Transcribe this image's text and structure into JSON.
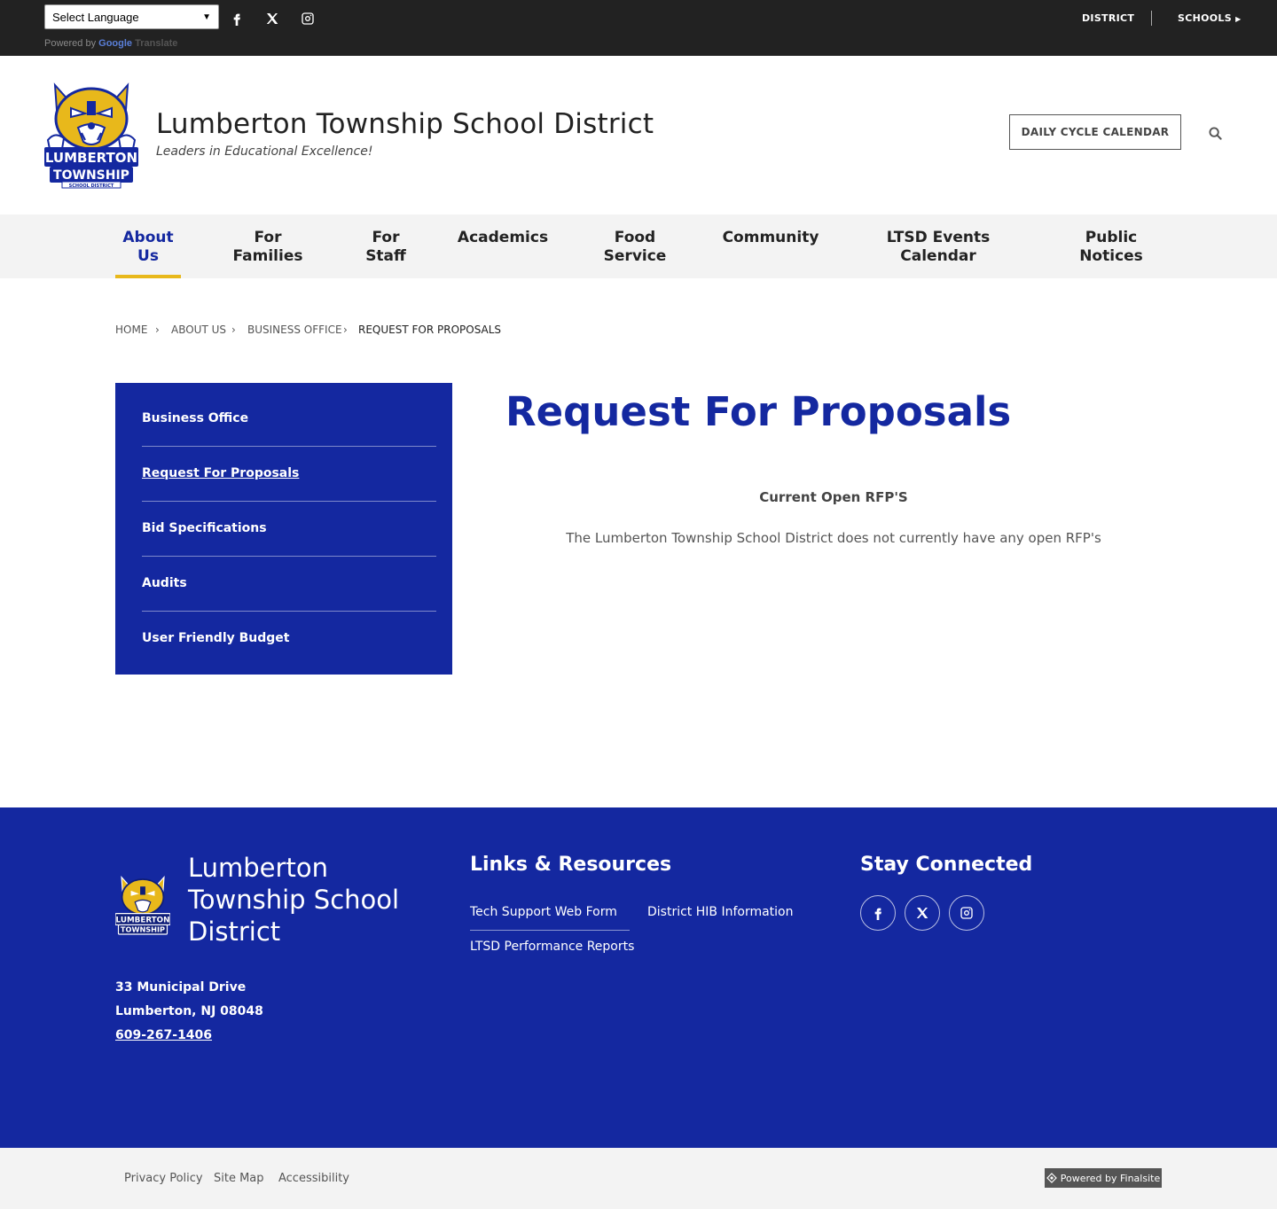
{
  "topbar": {
    "language_select": "Select Language",
    "powered_by": "Powered by",
    "google": "Google",
    "translate": "Translate",
    "social": [
      "facebook-icon",
      "x-icon",
      "instagram-icon"
    ],
    "district_link": "DISTRICT",
    "schools_link": "SCHOOLS"
  },
  "header": {
    "logo_text_1": "LUMBERTON",
    "logo_text_2": "TOWNSHIP",
    "logo_text_3": "SCHOOL DISTRICT",
    "title": "Lumberton Township School District",
    "tagline": "Leaders in Educational Excellence!",
    "calendar_button": "DAILY CYCLE CALENDAR"
  },
  "nav": {
    "items": [
      {
        "line1": "About",
        "line2": "Us"
      },
      {
        "line1": "For",
        "line2": "Families"
      },
      {
        "line1": "For",
        "line2": "Staff"
      },
      {
        "line1": "Academics",
        "line2": ""
      },
      {
        "line1": "Food",
        "line2": "Service"
      },
      {
        "line1": "Community",
        "line2": ""
      },
      {
        "line1": "LTSD Events",
        "line2": "Calendar"
      },
      {
        "line1": "Public",
        "line2": "Notices"
      }
    ]
  },
  "breadcrumb": [
    "HOME",
    "ABOUT US",
    "BUSINESS OFFICE",
    "REQUEST FOR PROPOSALS"
  ],
  "sidenav": {
    "items": [
      "Business Office",
      "Request For Proposals",
      "Bid Specifications",
      "Audits",
      "User Friendly Budget"
    ]
  },
  "content": {
    "title": "Request For Proposals",
    "subtitle": "Current Open RFP'S",
    "body": "The Lumberton Township School District does not currently have any open RFP's"
  },
  "footer": {
    "name": "Lumberton Township School District",
    "address_line1": "33 Municipal Drive",
    "address_line2": "Lumberton, NJ  08048",
    "phone": "609-267-1406",
    "links_heading": "Links & Resources",
    "links": [
      "Tech Support Web Form",
      "District HIB Information",
      "LTSD Performance Reports"
    ],
    "connect_heading": "Stay Connected"
  },
  "bottom": {
    "links": [
      "Privacy Policy",
      "Site Map",
      "Accessibility"
    ],
    "powered": "Powered by Finalsite"
  },
  "colors": {
    "brand_blue": "#1428a0",
    "accent_gold": "#e8b81b",
    "topbar": "#222222"
  }
}
